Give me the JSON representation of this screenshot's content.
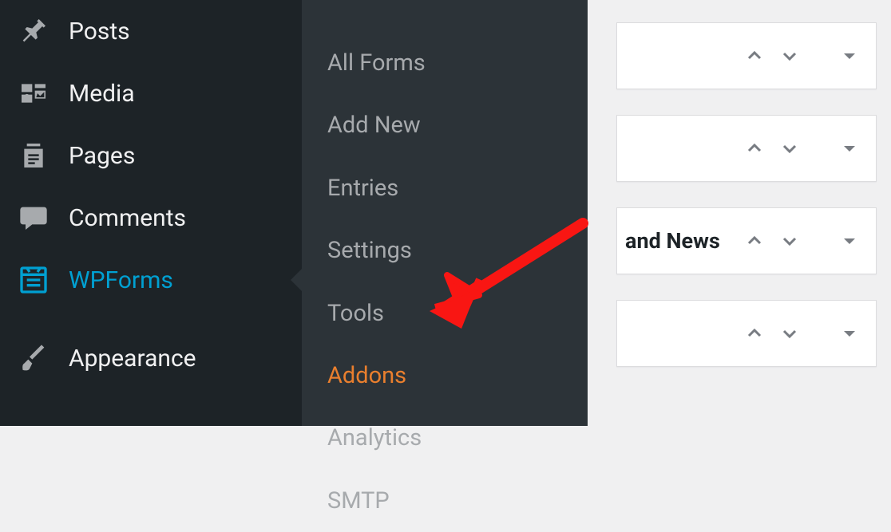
{
  "sidebar": {
    "items": [
      {
        "label": "Posts",
        "icon": "pin"
      },
      {
        "label": "Media",
        "icon": "media"
      },
      {
        "label": "Pages",
        "icon": "pages"
      },
      {
        "label": "Comments",
        "icon": "comment"
      },
      {
        "label": "WPForms",
        "icon": "wpforms",
        "active": true
      },
      {
        "label": "Appearance",
        "icon": "brush"
      }
    ]
  },
  "submenu": {
    "items": [
      {
        "label": "All Forms"
      },
      {
        "label": "Add New"
      },
      {
        "label": "Entries"
      },
      {
        "label": "Settings"
      },
      {
        "label": "Tools"
      },
      {
        "label": "Addons",
        "highlight": true
      },
      {
        "label": "Analytics"
      },
      {
        "label": "SMTP"
      }
    ]
  },
  "widgets": [
    {
      "title": ""
    },
    {
      "title": ""
    },
    {
      "title": "and News"
    },
    {
      "title": ""
    }
  ],
  "colors": {
    "sidebar_bg": "#1d2327",
    "submenu_bg": "#2c3338",
    "active_blue": "#00a0d2",
    "highlight_orange": "#e97f2e",
    "arrow_red": "#f91613"
  }
}
